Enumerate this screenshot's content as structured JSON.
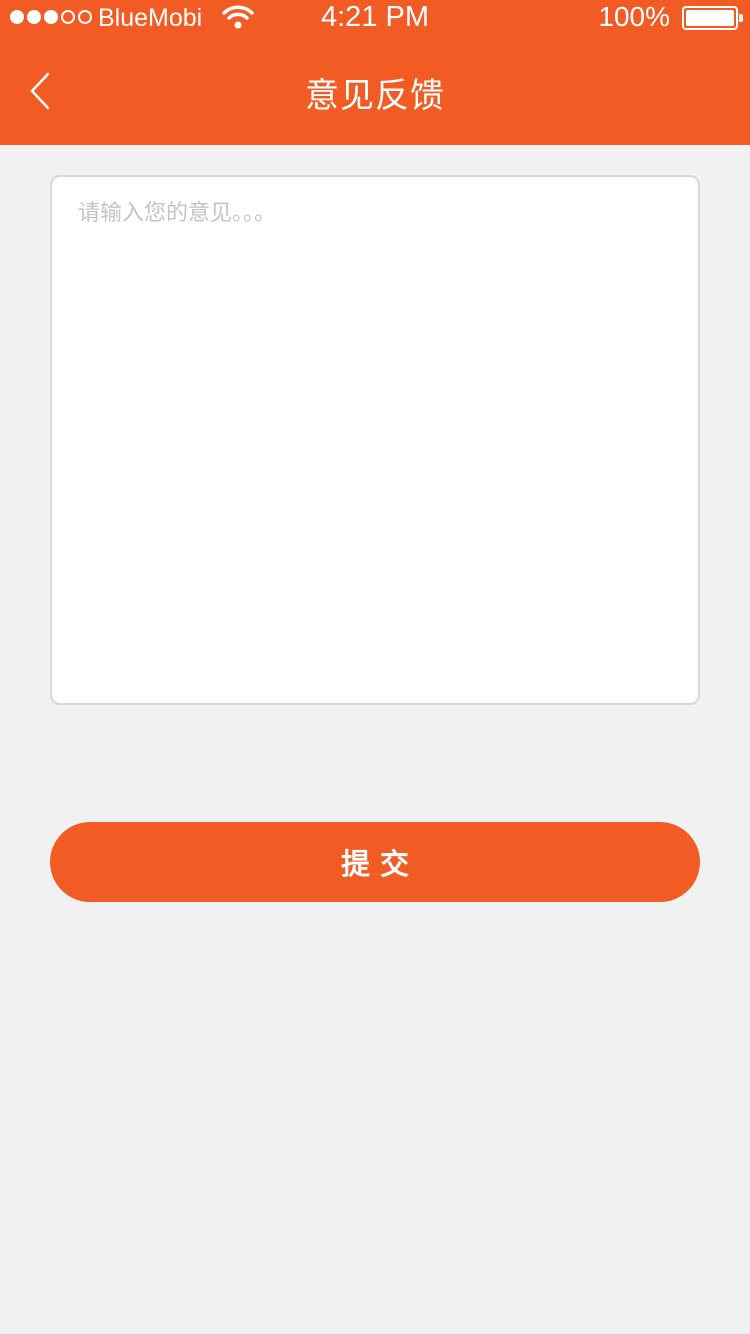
{
  "status_bar": {
    "carrier": "BlueMobi",
    "time": "4:21 PM",
    "battery": "100%",
    "signal_bars_filled": 3,
    "signal_bars_total": 5
  },
  "nav": {
    "title": "意见反馈",
    "back_icon": "chevron-left-icon"
  },
  "feedback": {
    "placeholder": "请输入您的意见。。。",
    "value": ""
  },
  "submit": {
    "label": "提交"
  },
  "colors": {
    "accent": "#f25c24",
    "background": "#f1f1f1"
  }
}
